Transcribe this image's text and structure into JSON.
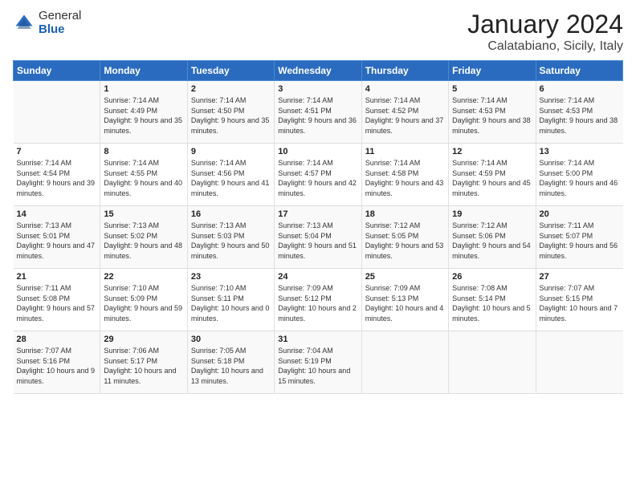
{
  "header": {
    "logo_general": "General",
    "logo_blue": "Blue",
    "title": "January 2024",
    "subtitle": "Calatabiano, Sicily, Italy"
  },
  "days_of_week": [
    "Sunday",
    "Monday",
    "Tuesday",
    "Wednesday",
    "Thursday",
    "Friday",
    "Saturday"
  ],
  "weeks": [
    [
      {
        "num": "",
        "sunrise": "",
        "sunset": "",
        "daylight": ""
      },
      {
        "num": "1",
        "sunrise": "Sunrise: 7:14 AM",
        "sunset": "Sunset: 4:49 PM",
        "daylight": "Daylight: 9 hours and 35 minutes."
      },
      {
        "num": "2",
        "sunrise": "Sunrise: 7:14 AM",
        "sunset": "Sunset: 4:50 PM",
        "daylight": "Daylight: 9 hours and 35 minutes."
      },
      {
        "num": "3",
        "sunrise": "Sunrise: 7:14 AM",
        "sunset": "Sunset: 4:51 PM",
        "daylight": "Daylight: 9 hours and 36 minutes."
      },
      {
        "num": "4",
        "sunrise": "Sunrise: 7:14 AM",
        "sunset": "Sunset: 4:52 PM",
        "daylight": "Daylight: 9 hours and 37 minutes."
      },
      {
        "num": "5",
        "sunrise": "Sunrise: 7:14 AM",
        "sunset": "Sunset: 4:53 PM",
        "daylight": "Daylight: 9 hours and 38 minutes."
      },
      {
        "num": "6",
        "sunrise": "Sunrise: 7:14 AM",
        "sunset": "Sunset: 4:53 PM",
        "daylight": "Daylight: 9 hours and 38 minutes."
      }
    ],
    [
      {
        "num": "7",
        "sunrise": "Sunrise: 7:14 AM",
        "sunset": "Sunset: 4:54 PM",
        "daylight": "Daylight: 9 hours and 39 minutes."
      },
      {
        "num": "8",
        "sunrise": "Sunrise: 7:14 AM",
        "sunset": "Sunset: 4:55 PM",
        "daylight": "Daylight: 9 hours and 40 minutes."
      },
      {
        "num": "9",
        "sunrise": "Sunrise: 7:14 AM",
        "sunset": "Sunset: 4:56 PM",
        "daylight": "Daylight: 9 hours and 41 minutes."
      },
      {
        "num": "10",
        "sunrise": "Sunrise: 7:14 AM",
        "sunset": "Sunset: 4:57 PM",
        "daylight": "Daylight: 9 hours and 42 minutes."
      },
      {
        "num": "11",
        "sunrise": "Sunrise: 7:14 AM",
        "sunset": "Sunset: 4:58 PM",
        "daylight": "Daylight: 9 hours and 43 minutes."
      },
      {
        "num": "12",
        "sunrise": "Sunrise: 7:14 AM",
        "sunset": "Sunset: 4:59 PM",
        "daylight": "Daylight: 9 hours and 45 minutes."
      },
      {
        "num": "13",
        "sunrise": "Sunrise: 7:14 AM",
        "sunset": "Sunset: 5:00 PM",
        "daylight": "Daylight: 9 hours and 46 minutes."
      }
    ],
    [
      {
        "num": "14",
        "sunrise": "Sunrise: 7:13 AM",
        "sunset": "Sunset: 5:01 PM",
        "daylight": "Daylight: 9 hours and 47 minutes."
      },
      {
        "num": "15",
        "sunrise": "Sunrise: 7:13 AM",
        "sunset": "Sunset: 5:02 PM",
        "daylight": "Daylight: 9 hours and 48 minutes."
      },
      {
        "num": "16",
        "sunrise": "Sunrise: 7:13 AM",
        "sunset": "Sunset: 5:03 PM",
        "daylight": "Daylight: 9 hours and 50 minutes."
      },
      {
        "num": "17",
        "sunrise": "Sunrise: 7:13 AM",
        "sunset": "Sunset: 5:04 PM",
        "daylight": "Daylight: 9 hours and 51 minutes."
      },
      {
        "num": "18",
        "sunrise": "Sunrise: 7:12 AM",
        "sunset": "Sunset: 5:05 PM",
        "daylight": "Daylight: 9 hours and 53 minutes."
      },
      {
        "num": "19",
        "sunrise": "Sunrise: 7:12 AM",
        "sunset": "Sunset: 5:06 PM",
        "daylight": "Daylight: 9 hours and 54 minutes."
      },
      {
        "num": "20",
        "sunrise": "Sunrise: 7:11 AM",
        "sunset": "Sunset: 5:07 PM",
        "daylight": "Daylight: 9 hours and 56 minutes."
      }
    ],
    [
      {
        "num": "21",
        "sunrise": "Sunrise: 7:11 AM",
        "sunset": "Sunset: 5:08 PM",
        "daylight": "Daylight: 9 hours and 57 minutes."
      },
      {
        "num": "22",
        "sunrise": "Sunrise: 7:10 AM",
        "sunset": "Sunset: 5:09 PM",
        "daylight": "Daylight: 9 hours and 59 minutes."
      },
      {
        "num": "23",
        "sunrise": "Sunrise: 7:10 AM",
        "sunset": "Sunset: 5:11 PM",
        "daylight": "Daylight: 10 hours and 0 minutes."
      },
      {
        "num": "24",
        "sunrise": "Sunrise: 7:09 AM",
        "sunset": "Sunset: 5:12 PM",
        "daylight": "Daylight: 10 hours and 2 minutes."
      },
      {
        "num": "25",
        "sunrise": "Sunrise: 7:09 AM",
        "sunset": "Sunset: 5:13 PM",
        "daylight": "Daylight: 10 hours and 4 minutes."
      },
      {
        "num": "26",
        "sunrise": "Sunrise: 7:08 AM",
        "sunset": "Sunset: 5:14 PM",
        "daylight": "Daylight: 10 hours and 5 minutes."
      },
      {
        "num": "27",
        "sunrise": "Sunrise: 7:07 AM",
        "sunset": "Sunset: 5:15 PM",
        "daylight": "Daylight: 10 hours and 7 minutes."
      }
    ],
    [
      {
        "num": "28",
        "sunrise": "Sunrise: 7:07 AM",
        "sunset": "Sunset: 5:16 PM",
        "daylight": "Daylight: 10 hours and 9 minutes."
      },
      {
        "num": "29",
        "sunrise": "Sunrise: 7:06 AM",
        "sunset": "Sunset: 5:17 PM",
        "daylight": "Daylight: 10 hours and 11 minutes."
      },
      {
        "num": "30",
        "sunrise": "Sunrise: 7:05 AM",
        "sunset": "Sunset: 5:18 PM",
        "daylight": "Daylight: 10 hours and 13 minutes."
      },
      {
        "num": "31",
        "sunrise": "Sunrise: 7:04 AM",
        "sunset": "Sunset: 5:19 PM",
        "daylight": "Daylight: 10 hours and 15 minutes."
      },
      {
        "num": "",
        "sunrise": "",
        "sunset": "",
        "daylight": ""
      },
      {
        "num": "",
        "sunrise": "",
        "sunset": "",
        "daylight": ""
      },
      {
        "num": "",
        "sunrise": "",
        "sunset": "",
        "daylight": ""
      }
    ]
  ]
}
